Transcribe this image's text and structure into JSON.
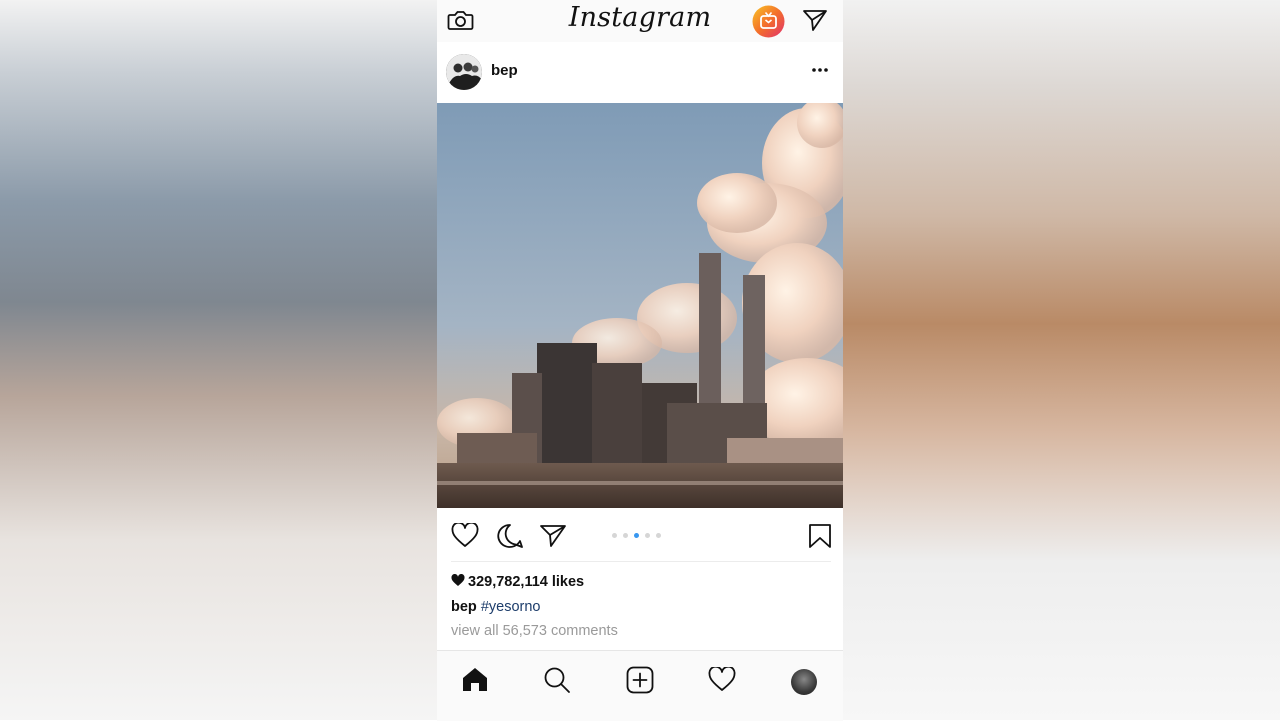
{
  "app": {
    "logo_text": "Instagram"
  },
  "header": {
    "icons": [
      "camera-icon",
      "igtv-icon",
      "direct-message-icon"
    ],
    "igtv_gradient": [
      "#f9a825",
      "#e1306c"
    ]
  },
  "post": {
    "username": "bep",
    "menu_icon": "more-options-icon",
    "carousel": {
      "count": 5,
      "active_index": 2,
      "active_color": "#3897f0"
    },
    "likes_text": "329,782,114 likes",
    "caption_user": "bep",
    "caption_hashtag": "#yesorno",
    "comments_text": "view all 56,573 comments"
  },
  "bottom_nav": {
    "items": [
      "home-icon",
      "search-icon",
      "new-post-icon",
      "activity-icon",
      "profile-icon"
    ]
  }
}
